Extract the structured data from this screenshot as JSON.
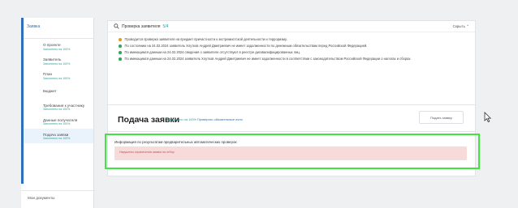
{
  "sidebar": {
    "header": "Заявка",
    "items": [
      {
        "label": "О проекте",
        "sub": "Заполнено на 100%"
      },
      {
        "label": "Заявитель",
        "sub": "Заполнено на 100%"
      },
      {
        "label": "План",
        "sub": "Заполнено на 100%"
      },
      {
        "label": "Бюджет",
        "sub": ""
      },
      {
        "label": "Требования к участнику",
        "sub": "Заполнено на 100%"
      },
      {
        "label": "Данные получателя",
        "sub": "Заполнено на 100%"
      },
      {
        "label": "Подача заявки",
        "sub": "Заполнено на 100%"
      }
    ],
    "footer": "Мои документы"
  },
  "check": {
    "title": "Проверка заявителя",
    "count": "5/4",
    "hide_label": "Скрыть",
    "lines": [
      {
        "status": "warn",
        "text": "Проводится проверка заявителя на предмет причастности к экстремистской деятельности и терроризму."
      },
      {
        "status": "ok",
        "text": "По состоянию на 24.02.2024 заявитель Хлутков Андрей Дмитриевич не имеет задолженности по денежным обязательствам перед Российской Федерацией."
      },
      {
        "status": "ok",
        "text": "По имеющимся данным на 24.02.2024 сведения о заявителе отсутствуют в реестре дисквалифицированных лиц."
      },
      {
        "status": "ok",
        "text": "По имеющимся данным на 24.02.2024 заявитель Хлутков Андрей Дмитриевич не имеет задолженности в соответствии с законодательством Российской Федерации о налогах и сборах."
      }
    ]
  },
  "submit": {
    "title": "Подача заявки",
    "fill": "Заполнено на 100%",
    "link": "Проверить обязательные поля",
    "button": "Подать заявку"
  },
  "info": {
    "title": "Информация по результатам предварительных автоматических проверок:",
    "message": "Нарушены ограничения заявки на отбор"
  },
  "colors": {
    "accent": "#2f6fb8",
    "ok": "#2ea85a",
    "warn": "#e0a020",
    "error_bg": "#f7dada",
    "highlight": "#44e344"
  }
}
